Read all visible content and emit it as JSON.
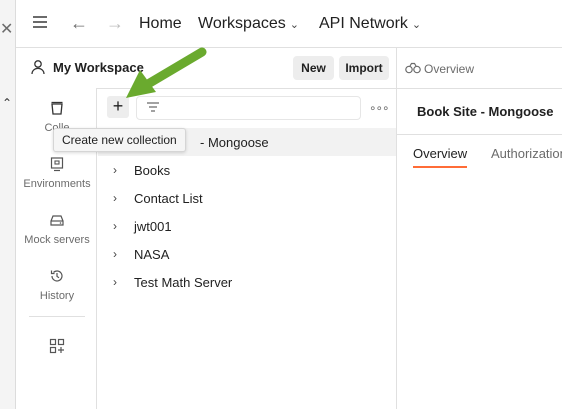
{
  "nav": {
    "home": "Home",
    "workspaces": "Workspaces",
    "api_network": "API Network"
  },
  "workspace": {
    "title": "My Workspace",
    "new_label": "New",
    "import_label": "Import"
  },
  "overview_tab": {
    "label": "Overview"
  },
  "rail": {
    "items": [
      {
        "label": "Colle",
        "icon": "collections-icon"
      },
      {
        "label": "Environments",
        "icon": "environments-icon"
      },
      {
        "label": "Mock servers",
        "icon": "mock-servers-icon"
      },
      {
        "label": "History",
        "icon": "history-icon"
      }
    ]
  },
  "tooltip": {
    "text": "Create new collection"
  },
  "collections": [
    {
      "name": "- Mongoose",
      "selected": true
    },
    {
      "name": "Books"
    },
    {
      "name": "Contact List"
    },
    {
      "name": "jwt001"
    },
    {
      "name": "NASA"
    },
    {
      "name": "Test Math Server"
    }
  ],
  "right_pane": {
    "title": "Book Site - Mongoose",
    "tabs": [
      "Overview",
      "Authorization"
    ]
  },
  "colors": {
    "accent": "#ff6c37",
    "annotation_arrow": "#6aaa2e"
  }
}
